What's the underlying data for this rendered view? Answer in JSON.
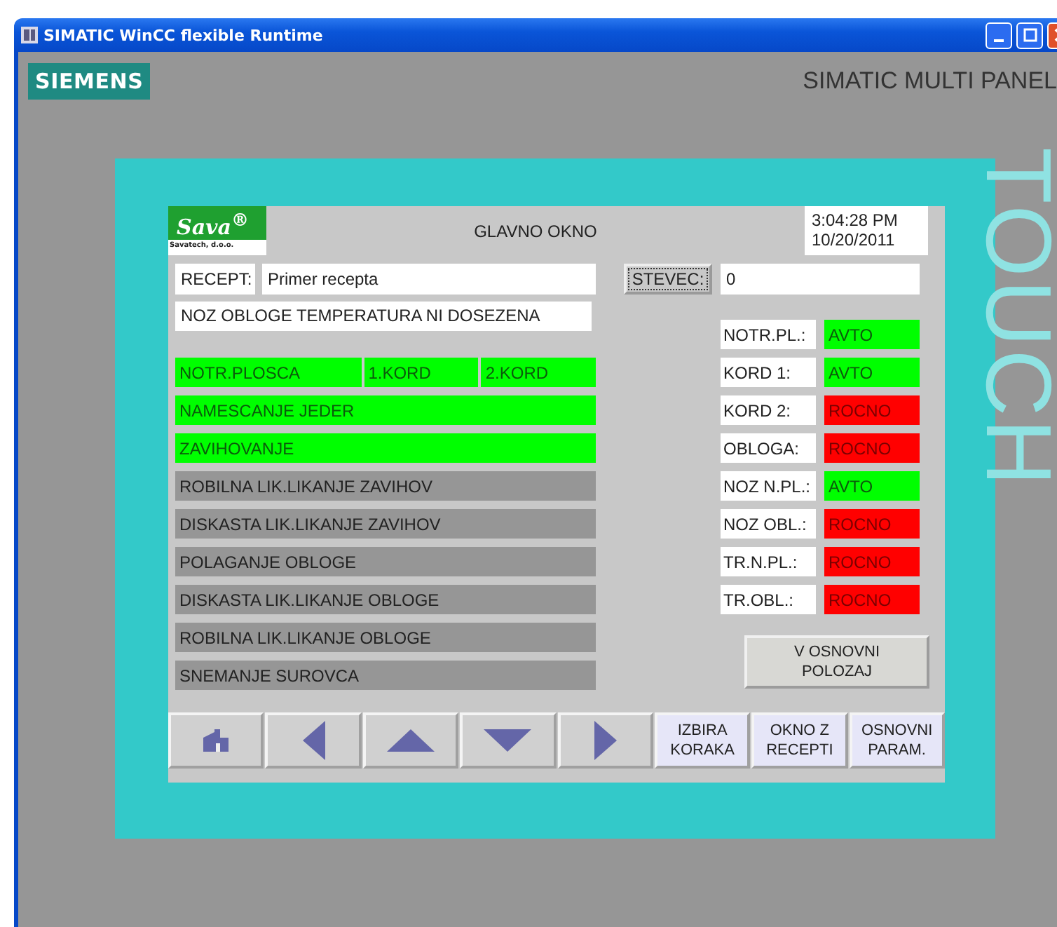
{
  "window": {
    "title": "SIMATIC WinCC flexible Runtime"
  },
  "panel": {
    "brand": "SIEMENS",
    "model": "SIMATIC MULTI PANEL",
    "touch": "TOUCH"
  },
  "screen": {
    "logo": "Sava$^{®}$",
    "logo_sub": "Savatech, d.o.o.",
    "title": "GLAVNO OKNO",
    "time": "3:04:28 PM",
    "date": "10/20/2011",
    "recipe_label": "RECEPT:",
    "recipe_value": "Primer recepta",
    "counter_button": "STEVEC:",
    "counter_value": "0",
    "message": "NOZ OBLOGE TEMPERATURA NI DOSEZENA",
    "steps": [
      {
        "parts": [
          "NOTR.PLOSCA",
          "1.KORD",
          "2.KORD"
        ],
        "active": true
      },
      {
        "parts": [
          "NAMESCANJE JEDER"
        ],
        "active": true
      },
      {
        "parts": [
          "ZAVIHOVANJE"
        ],
        "active": true
      },
      {
        "parts": [
          "ROBILNA LIK.LIKANJE ZAVIHOV"
        ],
        "active": false
      },
      {
        "parts": [
          "DISKASTA LIK.LIKANJE ZAVIHOV"
        ],
        "active": false
      },
      {
        "parts": [
          "POLAGANJE OBLOGE"
        ],
        "active": false
      },
      {
        "parts": [
          "DISKASTA LIK.LIKANJE OBLOGE"
        ],
        "active": false
      },
      {
        "parts": [
          "ROBILNA LIK.LIKANJE OBLOGE"
        ],
        "active": false
      },
      {
        "parts": [
          "SNEMANJE SUROVCA"
        ],
        "active": false
      }
    ],
    "modes": [
      {
        "label": "NOTR.PL.:",
        "value": "AVTO",
        "color": "#00ff00"
      },
      {
        "label": "KORD 1:",
        "value": "AVTO",
        "color": "#00ff00"
      },
      {
        "label": "KORD 2:",
        "value": "ROCNO",
        "color": "#ff0000"
      },
      {
        "label": "OBLOGA:",
        "value": "ROCNO",
        "color": "#ff0000"
      },
      {
        "label": "NOZ N.PL.:",
        "value": "AVTO",
        "color": "#00ff00"
      },
      {
        "label": "NOZ OBL.:",
        "value": "ROCNO",
        "color": "#ff0000"
      },
      {
        "label": "TR.N.PL.:",
        "value": "ROCNO",
        "color": "#ff0000"
      },
      {
        "label": "TR.OBL.:",
        "value": "ROCNO",
        "color": "#ff0000"
      }
    ],
    "home_position_button": "V OSNOVNI POLOZAJ",
    "nav": [
      {
        "kind": "home"
      },
      {
        "kind": "left"
      },
      {
        "kind": "up"
      },
      {
        "kind": "down"
      },
      {
        "kind": "right"
      },
      {
        "kind": "text",
        "label": "IZBIRA KORAKA"
      },
      {
        "kind": "text",
        "label": "OKNO Z RECEPTI"
      },
      {
        "kind": "text",
        "label": "OSNOVNI PARAM."
      }
    ]
  }
}
